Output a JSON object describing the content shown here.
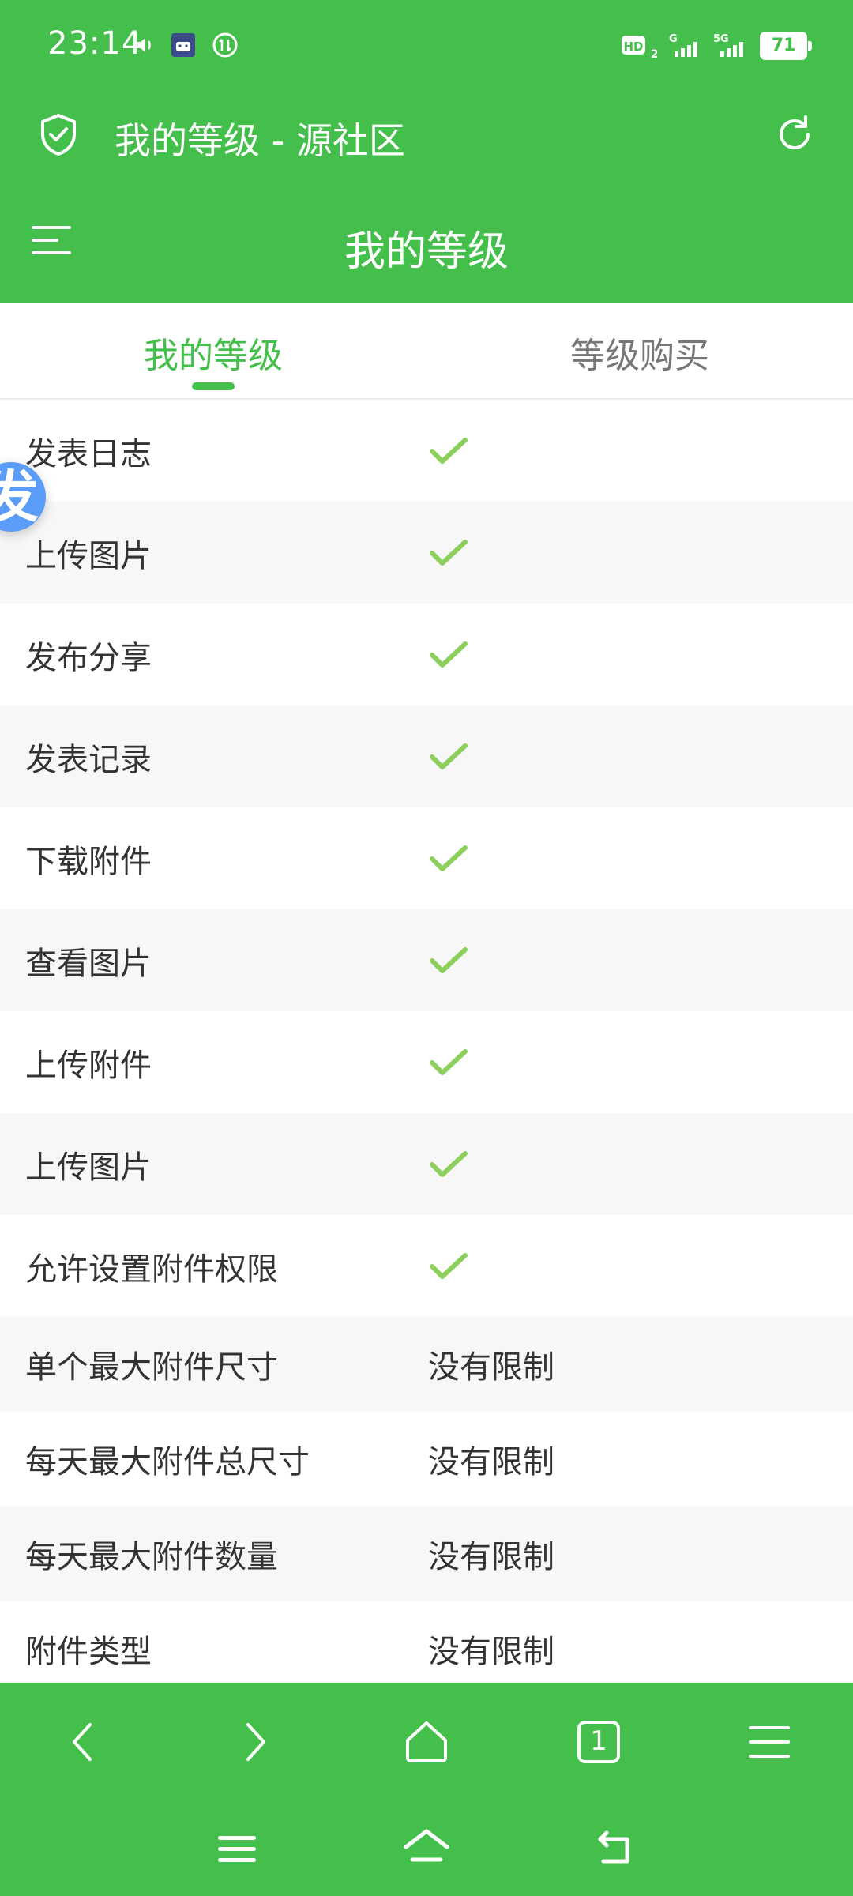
{
  "status": {
    "time": "23:14",
    "battery": "71",
    "network_left": "HD",
    "network_sub": "2",
    "sig1": "G",
    "sig2": "5G"
  },
  "title_bar": {
    "title": "我的等级 - 源社区"
  },
  "header": {
    "title": "我的等级"
  },
  "tabs": [
    {
      "label": "我的等级",
      "active": true
    },
    {
      "label": "等级购买",
      "active": false
    }
  ],
  "floating_button": {
    "label": "发"
  },
  "rows": [
    {
      "label": "发表日志",
      "value": "check"
    },
    {
      "label": "上传图片",
      "value": "check"
    },
    {
      "label": "发布分享",
      "value": "check"
    },
    {
      "label": "发表记录",
      "value": "check"
    },
    {
      "label": "下载附件",
      "value": "check"
    },
    {
      "label": "查看图片",
      "value": "check"
    },
    {
      "label": "上传附件",
      "value": "check"
    },
    {
      "label": "上传图片",
      "value": "check"
    },
    {
      "label": "允许设置附件权限",
      "value": "check"
    },
    {
      "label": "单个最大附件尺寸",
      "value": "没有限制"
    },
    {
      "label": "每天最大附件总尺寸",
      "value": "没有限制"
    },
    {
      "label": "每天最大附件数量",
      "value": "没有限制"
    },
    {
      "label": "附件类型",
      "value": "没有限制"
    }
  ],
  "browser_toolbar": {
    "tab_count": "1"
  },
  "colors": {
    "accent": "#45bf4b",
    "check": "#8ccf5c",
    "float_button": "#5a9cf8"
  },
  "icons": [
    "shield-check-icon",
    "refresh-icon",
    "menu-icon",
    "check-icon",
    "back-icon",
    "forward-icon",
    "home-icon",
    "tabs-icon",
    "more-menu-icon",
    "system-menu-icon",
    "system-home-icon",
    "system-back-icon"
  ]
}
